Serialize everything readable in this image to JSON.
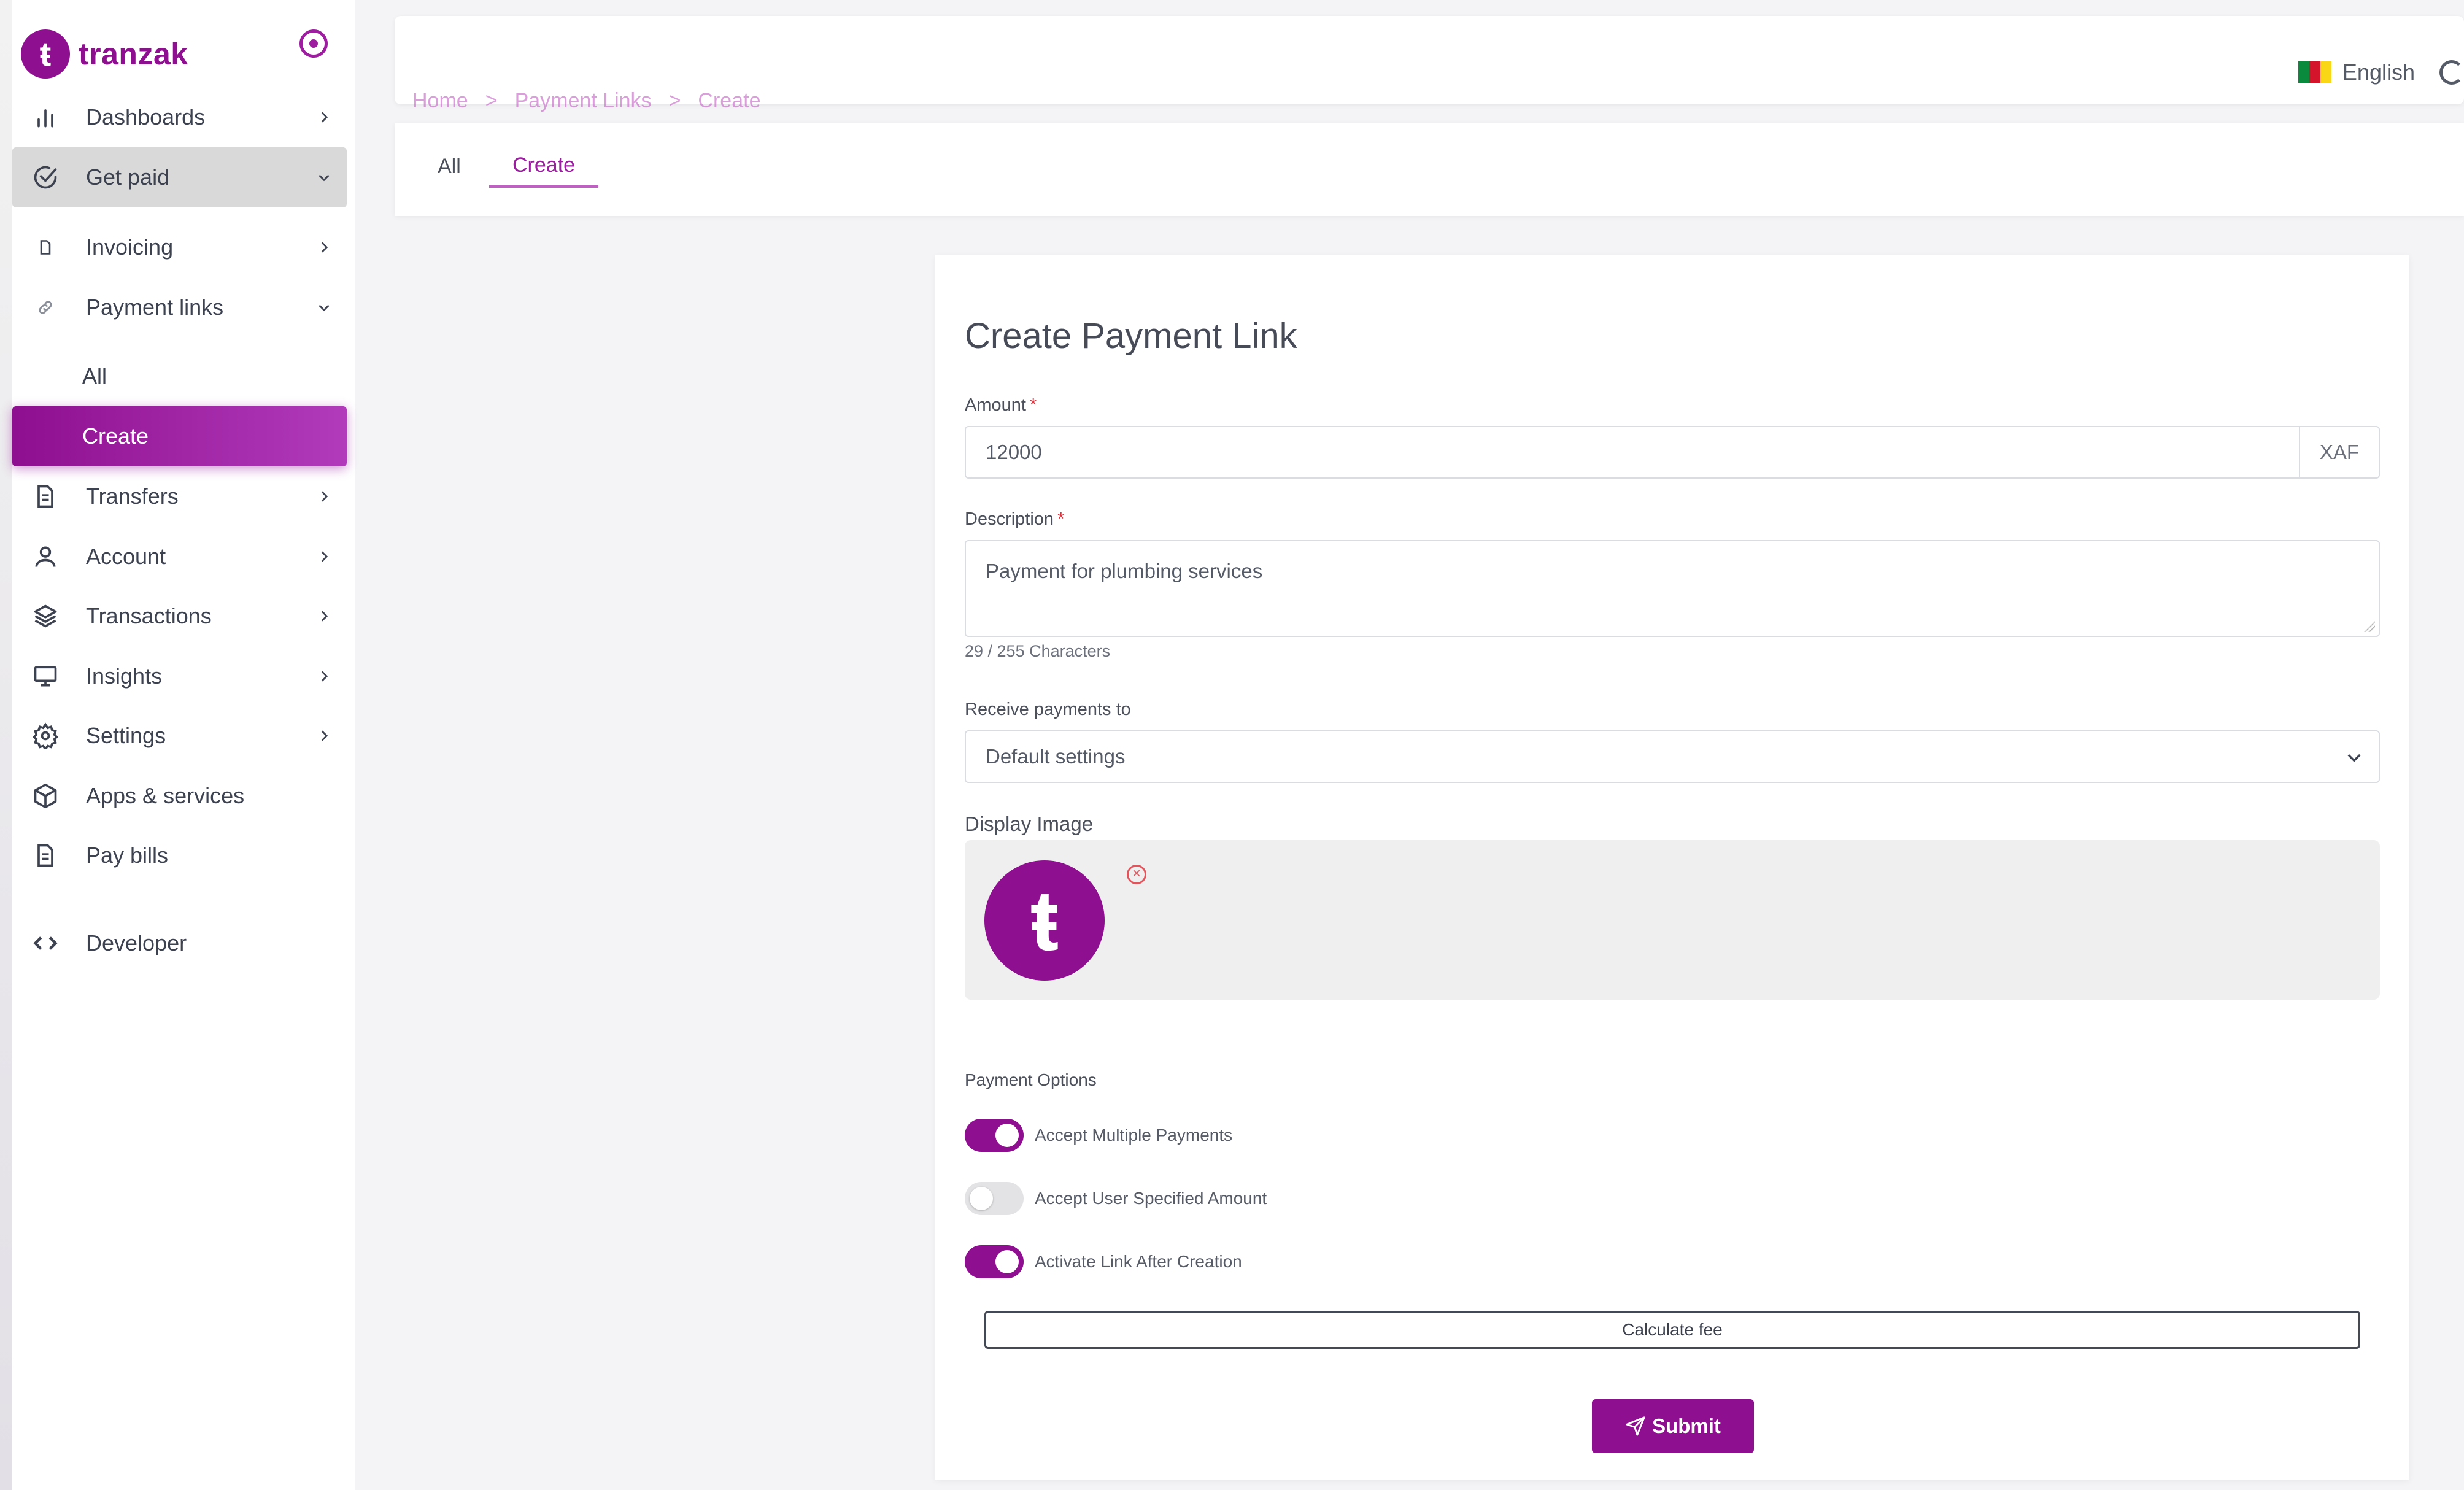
{
  "app": {
    "brand": "tranzak",
    "brand_glyph": "ŧ"
  },
  "sidebar": {
    "items": [
      {
        "label": "Dashboards",
        "icon": "bar-chart-icon"
      },
      {
        "label": "Get paid",
        "icon": "check-circle-icon"
      },
      {
        "label": "Invoicing",
        "icon": "file-icon"
      },
      {
        "label": "Payment links",
        "icon": "link-icon"
      },
      {
        "label": "All"
      },
      {
        "label": "Create"
      },
      {
        "label": "Transfers",
        "icon": "document-icon"
      },
      {
        "label": "Account",
        "icon": "user-icon"
      },
      {
        "label": "Transactions",
        "icon": "layers-icon"
      },
      {
        "label": "Insights",
        "icon": "monitor-icon"
      },
      {
        "label": "Settings",
        "icon": "gear-icon"
      },
      {
        "label": "Apps & services",
        "icon": "box-icon"
      },
      {
        "label": "Pay bills",
        "icon": "document-icon"
      },
      {
        "label": "Developer",
        "icon": "code-icon"
      }
    ]
  },
  "header": {
    "language": "English",
    "breadcrumb": [
      "Home",
      ">",
      "Payment Links",
      ">",
      "Create"
    ]
  },
  "tabs": [
    {
      "label": "All",
      "active": false
    },
    {
      "label": "Create",
      "active": true
    }
  ],
  "form": {
    "title": "Create Payment Link",
    "amount_label": "Amount",
    "amount_value": "12000",
    "amount_currency": "XAF",
    "description_label": "Description",
    "description_value": "Payment for plumbing services",
    "char_count": "29 / 255 Characters",
    "receive_label": "Receive payments to",
    "receive_value": "Default settings",
    "display_image_label": "Display Image",
    "payment_options_label": "Payment Options",
    "options": [
      {
        "label": "Accept Multiple Payments",
        "enabled": true
      },
      {
        "label": "Accept User Specified Amount",
        "enabled": false
      },
      {
        "label": "Activate Link After Creation",
        "enabled": true
      }
    ],
    "calculate_label": "Calculate fee",
    "submit_label": "Submit"
  },
  "colors": {
    "brand": "#8e0f8f",
    "accent_light": "#c25fc4",
    "required": "#e0303a"
  }
}
